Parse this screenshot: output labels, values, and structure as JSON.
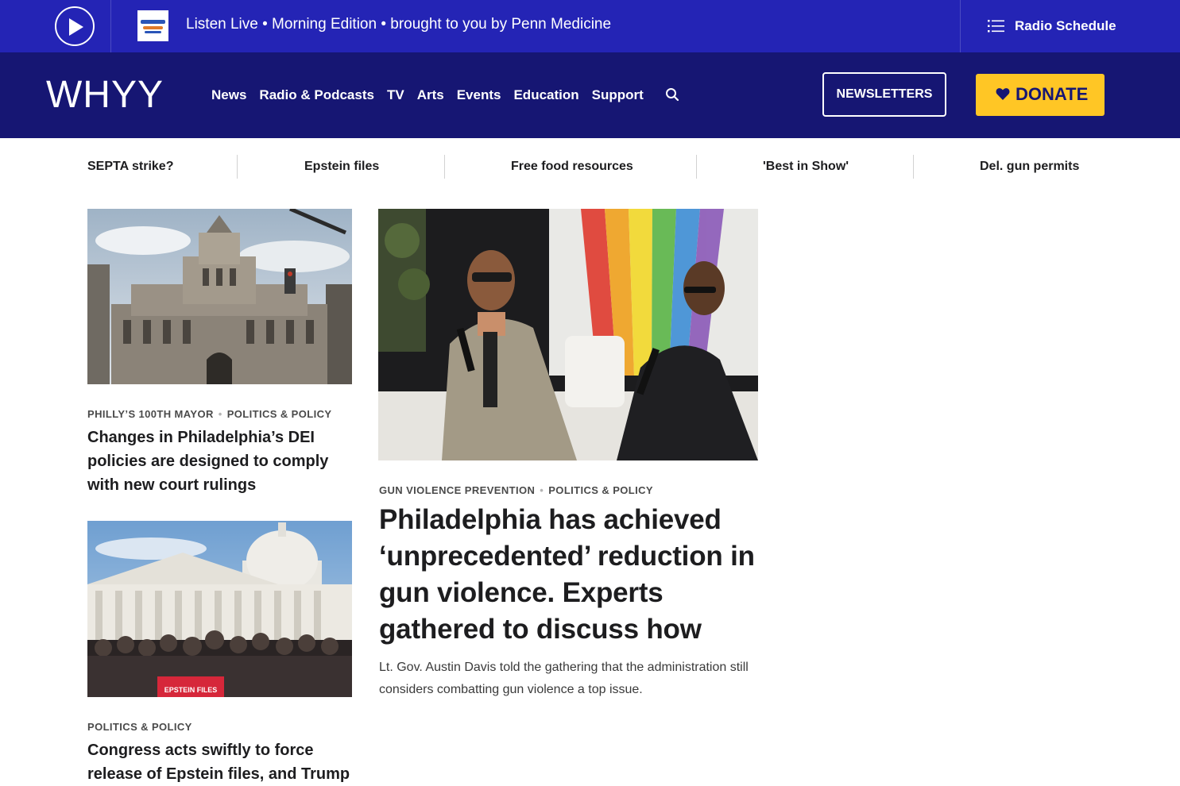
{
  "live_bar": {
    "listen_text": "Listen Live • Morning Edition • brought to you by Penn Medicine",
    "show_logo_text": "morning edition",
    "schedule_label": "Radio Schedule",
    "icons": {
      "play": "play-icon",
      "schedule": "list-icon"
    }
  },
  "header": {
    "logo": "WHYY",
    "nav": [
      "News",
      "Radio & Podcasts",
      "TV",
      "Arts",
      "Events",
      "Education",
      "Support"
    ],
    "newsletters_label": "NEWSLETTERS",
    "donate_label": "DONATE",
    "icons": {
      "search": "search-icon",
      "donate": "heart-icon"
    }
  },
  "trending": [
    "SEPTA strike?",
    "Epstein files",
    "Free food resources",
    "'Best in Show'",
    "Del. gun permits"
  ],
  "stories": {
    "dei": {
      "image_subject": "Philadelphia City Hall",
      "tags": [
        "PHILLY’S 100TH MAYOR",
        "POLITICS & POLICY"
      ],
      "headline": "Changes in Philadelphia’s DEI policies are designed to comply with new court rulings"
    },
    "gun": {
      "image_subject": "Two men in conversation on stage",
      "tags": [
        "GUN VIOLENCE PREVENTION",
        "POLITICS & POLICY"
      ],
      "headline": "Philadelphia has achieved ‘unprecedented’ reduction in gun violence. Experts gathered to discuss how",
      "dek": "Lt. Gov. Austin Davis told the gathering that the administration still considers combatting gun violence a top issue."
    },
    "epstein": {
      "image_subject": "U.S. Capitol press conference",
      "sign_text": "EPSTEIN FILES",
      "tags": [
        "POLITICS & POLICY"
      ],
      "headline": "Congress acts swiftly to force release of Epstein files, and Trump"
    }
  },
  "colors": {
    "live_bar": "#2424b5",
    "nav_bar": "#161673",
    "donate": "#ffc625",
    "text": "#1d1d1f",
    "tag": "#4a4a4a"
  }
}
